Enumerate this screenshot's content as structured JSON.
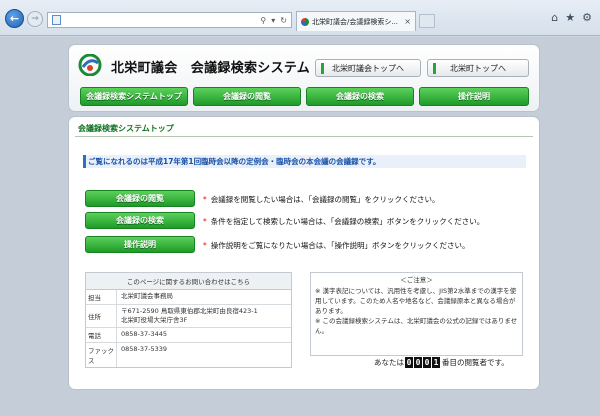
{
  "browser": {
    "tab_title": "北栄町議会/会議録検索シ...",
    "tab_close": "×",
    "search_icon": "search-icon",
    "refresh_icon": "refresh-icon"
  },
  "header": {
    "site_title": "北栄町議会　会議録検索システム",
    "top_link_council": "北栄町議会トップへ",
    "top_link_town": "北栄町トップへ",
    "nav": [
      "会議録検索システムトップ",
      "会議録の閲覧",
      "会議録の検索",
      "操作説明"
    ]
  },
  "main": {
    "section_title": "会議録検索システムトップ",
    "intro": "ご覧になれるのは平成17年第1回臨時会以降の定例会・臨時会の本会議の会議録です。",
    "actions": [
      {
        "label": "会議録の閲覧",
        "desc": "会議録を閲覧したい場合は、「会議録の閲覧」をクリックください。"
      },
      {
        "label": "会議録の検索",
        "desc": "条件を指定して検索したい場合は、「会議録の検索」ボタンをクリックください。"
      },
      {
        "label": "操作説明",
        "desc": "操作説明をご覧になりたい場合は、「操作説明」ボタンをクリックください。"
      }
    ],
    "asterisk": "*",
    "contact": {
      "heading": "このページに関するお問い合わせはこちら",
      "rows": [
        {
          "key": "担当",
          "val": "北栄町議会事務局"
        },
        {
          "key": "住所",
          "val": "〒671-2590 鳥取県東伯郡北栄町由良宿423-1"
        },
        {
          "key": "",
          "val": "北栄町役場大栄庁舎3F"
        },
        {
          "key": "電話",
          "val": "0858-37-3445"
        },
        {
          "key": "ファックス",
          "val": "0858-37-5339"
        }
      ]
    },
    "note": {
      "title": "＜ご注意＞",
      "p1": "※ 漢字表記については、汎用性を考慮し、JIS第2水準までの漢字を使用しています。このため人名や地名など、会議録原本と異なる場合があります。",
      "p2": "※ この会議録検索システムは、北栄町議会の公式の記録ではありません。"
    },
    "counter": {
      "prefix": "あなたは",
      "digits": [
        "0",
        "0",
        "0",
        "1"
      ],
      "suffix": "番目の閲覧者です。"
    }
  }
}
